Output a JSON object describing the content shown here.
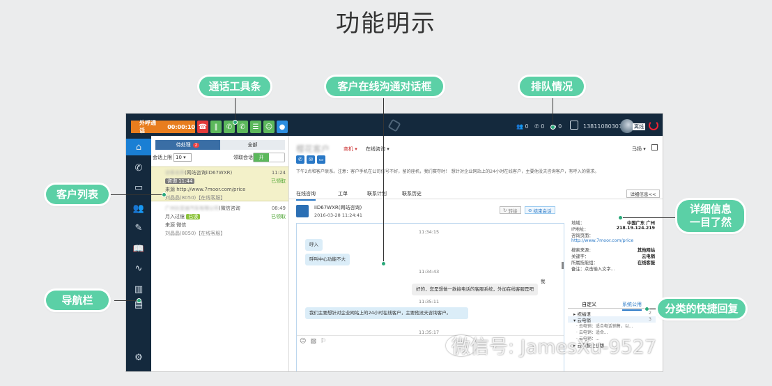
{
  "page_title": "功能明示",
  "callouts": {
    "toolbar": "通话工具条",
    "chat": "客户在线沟通对话框",
    "queue": "排队情况",
    "customer_list": "客户列表",
    "details": "详细信息\n一目了然",
    "nav": "导航栏",
    "quick_reply": "分类的快捷回复"
  },
  "topbar": {
    "outbound_label": "外呼通话",
    "timer": "00:00:10",
    "queue_counts": [
      "0",
      "0",
      "0"
    ],
    "phone": "13811080307",
    "agent_badge": "离线",
    "colors": {
      "bar": "#14293d",
      "outbound": "#e87d1e",
      "hangup": "#e23a3a",
      "green": "#5cb85c",
      "blue": "#2b8de0"
    }
  },
  "nav_icons": [
    "home-icon",
    "phone-icon",
    "chat-icon",
    "users-icon",
    "edit-icon",
    "book-icon",
    "pulse-icon",
    "chart-icon",
    "clipboard-icon",
    "gear-icon"
  ],
  "list": {
    "tab_pending": "待处理",
    "tab_pending_count": "2",
    "tab_all": "全部",
    "limit_label": "会话上限",
    "limit_value": "10",
    "claim_label": "领取会话 :",
    "toggle": "开",
    "items": [
      {
        "name": "访客名称",
        "channel": "(网站咨询iiD67WXR)",
        "time": "11:24",
        "status": "已领取",
        "chip": "咨询 11:44",
        "source": "来源 http://www.7moor.com/price",
        "agent": "刘晶晶(8050)【在线客服】"
      },
      {
        "name": "广州比亚迪汽车有限公司",
        "channel": "(微信咨询",
        "time": "08:49",
        "status": "已领取",
        "chip_prefix": "月入过億",
        "chip": "已读",
        "source": "来源 微信",
        "agent": "刘晶晶(8050)【在线客服】"
      }
    ]
  },
  "main": {
    "customer": "樱花客户",
    "tag1": "商机",
    "tag2": "在线咨询",
    "agent": "马扬",
    "description": "下午2点和客户联系。注意：客户手机在公司信号不好，留的座机，我们赛夺时！ 想针对企业网站上的24小时在线客户，主要他没夫咨询客户，有呼入的需求。",
    "tabs": [
      "在线咨询",
      "工单",
      "联系计划",
      "联系历史"
    ],
    "detail_button": "详细信息<<",
    "chat_name": "iiD67WXR(网站咨询)",
    "chat_date": "2016-03-28 11:24:41",
    "transfer": "转接",
    "end": "结束会话",
    "messages": [
      {
        "type": "ts",
        "text": "11:34:15"
      },
      {
        "type": "in",
        "text": "呼入"
      },
      {
        "type": "in",
        "text": "呼叫中心功能不大"
      },
      {
        "type": "ts",
        "text": "11:34:43"
      },
      {
        "type": "me",
        "text": "我"
      },
      {
        "type": "out",
        "text": "好的，您是想做一款接电话的客服系统，外加在线客服是吧"
      },
      {
        "type": "ts",
        "text": "11:35:11"
      },
      {
        "type": "in",
        "text": "我们主要想针对企业网站上的24小时在线客户，主要他没夫咨询客户。"
      },
      {
        "type": "ts",
        "text": "11:35:17"
      }
    ]
  },
  "info": {
    "rows": [
      {
        "label": "地域：",
        "value": "中国广东 广州"
      },
      {
        "label": "IP地址：",
        "value": "218.19.124.219"
      },
      {
        "label": "咨询页面：",
        "value": "http://www.7moor.com/price",
        "link": true
      },
      {
        "label": "搜索来源：",
        "value": "其他网站"
      },
      {
        "label": "关键字：",
        "value": "云电销"
      },
      {
        "label": "所属技能组：",
        "value": "在线客服"
      },
      {
        "label": "备注：点击输入文字...",
        "value": ""
      }
    ]
  },
  "quick_reply": {
    "tab_custom": "自定义",
    "tab_system": "系统公用",
    "rows": [
      {
        "label": "祝福语",
        "count": "2",
        "cls": ""
      },
      {
        "label": "云电销",
        "count": "3",
        "cls": "sel"
      },
      {
        "label": "云电销：适合电话销售，以...",
        "count": "",
        "cls": "sub"
      },
      {
        "label": "云电销：适合...",
        "count": "",
        "cls": "sub"
      },
      {
        "label": "云电销：...",
        "count": "",
        "cls": "sub"
      },
      {
        "label": "云客服企业版",
        "count": "",
        "cls": ""
      }
    ]
  },
  "watermark": "微信号: JamesXu-9527"
}
